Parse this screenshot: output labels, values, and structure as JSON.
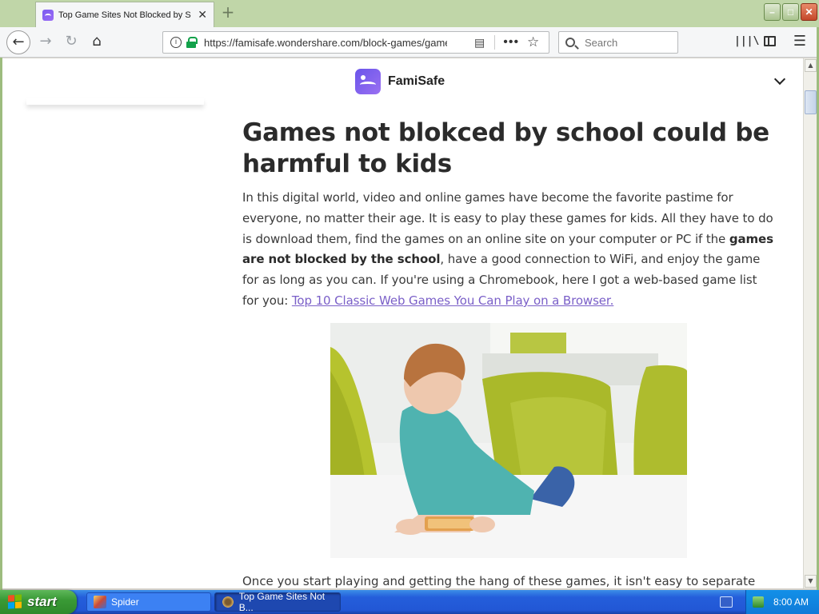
{
  "browser": {
    "tab_title": "Top Game Sites Not Blocked by School",
    "url": "https://famisafe.wondershare.com/block-games/game",
    "search_placeholder": "Search",
    "new_tab_label": "+",
    "icons": [
      "back-icon",
      "forward-icon",
      "reload-icon",
      "home-icon",
      "info-icon",
      "lock-icon",
      "reader-view-icon",
      "page-actions-icon",
      "bookmark-star-icon",
      "search-icon",
      "library-icon",
      "sidebar-icon",
      "menu-icon"
    ]
  },
  "site": {
    "brand": "FamiSafe"
  },
  "article": {
    "heading": "Games not blokced by school could be harmful to kids",
    "para_part1": "In this digital world, video and online games have become the favorite pastime for everyone, no matter their age. It is easy to play these games for kids. All they have to do is download them, find the games on an online site on your computer or PC if the ",
    "para_bold": "games are not blocked by the school",
    "para_part2": ", have a good connection to WiFi, and enjoy the game for as long as you can. If you're using a Chromebook, here I got a web-based game list for you: ",
    "link_text": "Top 10 Classic Web Games You Can Play on a Browser.",
    "next_para": "Once you start playing and getting the hang of these games, it isn't easy to separate"
  },
  "taskbar": {
    "start_label": "start",
    "tasks": [
      {
        "label": "Spider"
      },
      {
        "label": "Top Game Sites Not B..."
      }
    ],
    "clock": "8:00 AM"
  },
  "colors": {
    "link": "#7a5fc8",
    "brand": "#7b5cf0",
    "taskbar": "#245edb",
    "start_green": "#3a9a36"
  }
}
